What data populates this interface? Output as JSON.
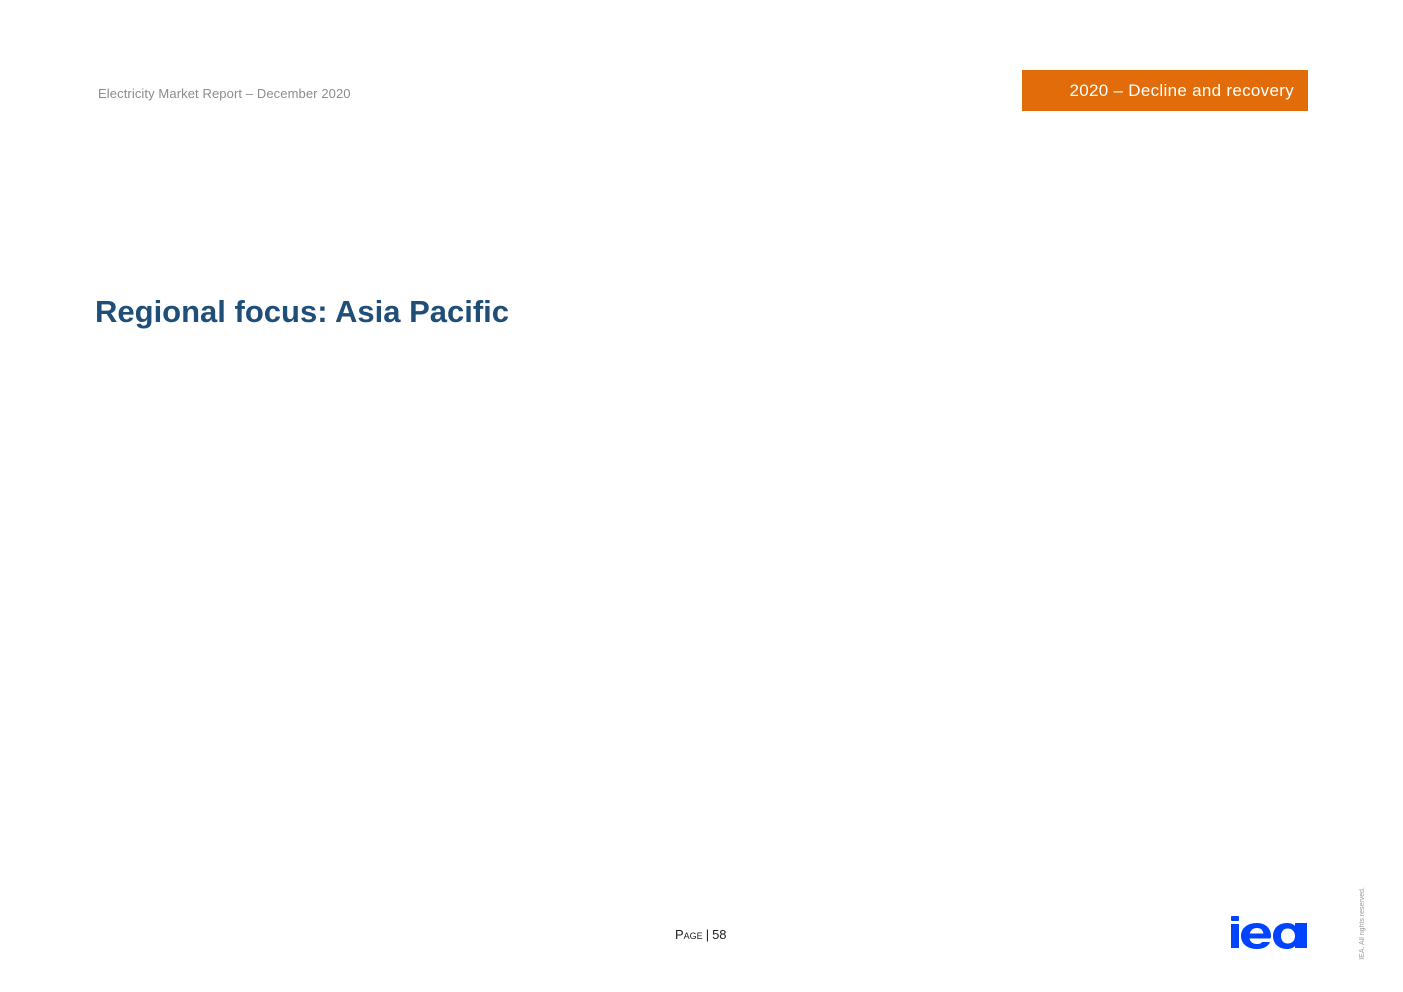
{
  "header": {
    "report_title": "Electricity Market Report – December 2020",
    "section_tab": "2020 – Decline and recovery"
  },
  "main": {
    "title": "Regional focus: Asia Pacific"
  },
  "footer": {
    "page_label": "Page",
    "separator": "|",
    "page_number": "58",
    "logo_text": "iea",
    "copyright": "IEA. All rights reserved."
  },
  "colors": {
    "accent_orange": "#e36c0a",
    "title_blue": "#1f4e79",
    "logo_blue": "#0044ff",
    "header_grey": "#8c8c8c"
  }
}
